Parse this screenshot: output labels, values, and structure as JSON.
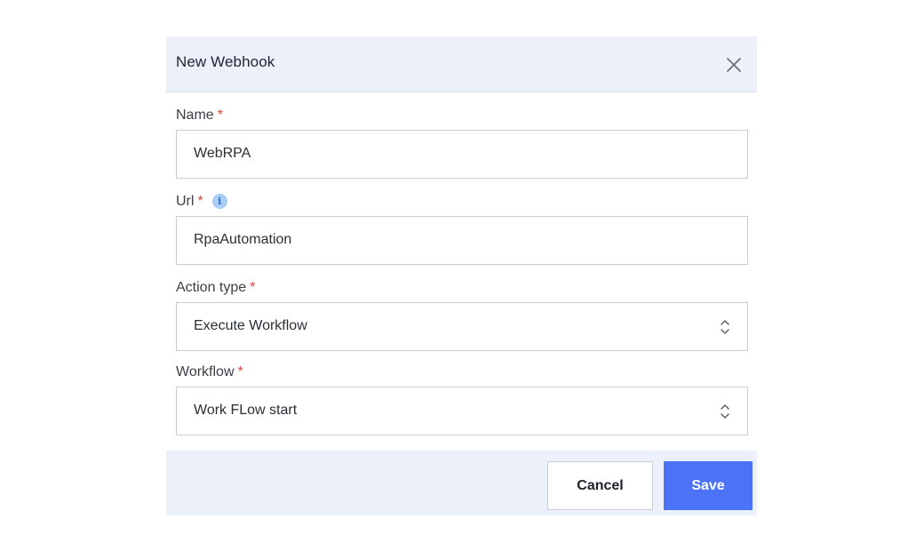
{
  "dialog": {
    "title": "New Webhook",
    "close_icon": "close-icon"
  },
  "fields": {
    "name": {
      "label": "Name",
      "required_marker": "*",
      "value": "WebRPA"
    },
    "url": {
      "label": "Url",
      "required_marker": "*",
      "info_icon": "info-icon",
      "info_glyph": "i",
      "value": "RpaAutomation"
    },
    "action_type": {
      "label": "Action type",
      "required_marker": "*",
      "selected": "Execute Workflow",
      "arrow_icon": "updown-chevron-icon"
    },
    "workflow": {
      "label": "Workflow",
      "required_marker": "*",
      "selected": "Work FLow start",
      "arrow_icon": "updown-chevron-icon"
    }
  },
  "footer": {
    "cancel_label": "Cancel",
    "save_label": "Save"
  },
  "colors": {
    "header_bg": "#ebf0fb",
    "required": "#e0443c",
    "primary": "#4c73f5",
    "info_icon_bg": "#a9cdf5"
  }
}
